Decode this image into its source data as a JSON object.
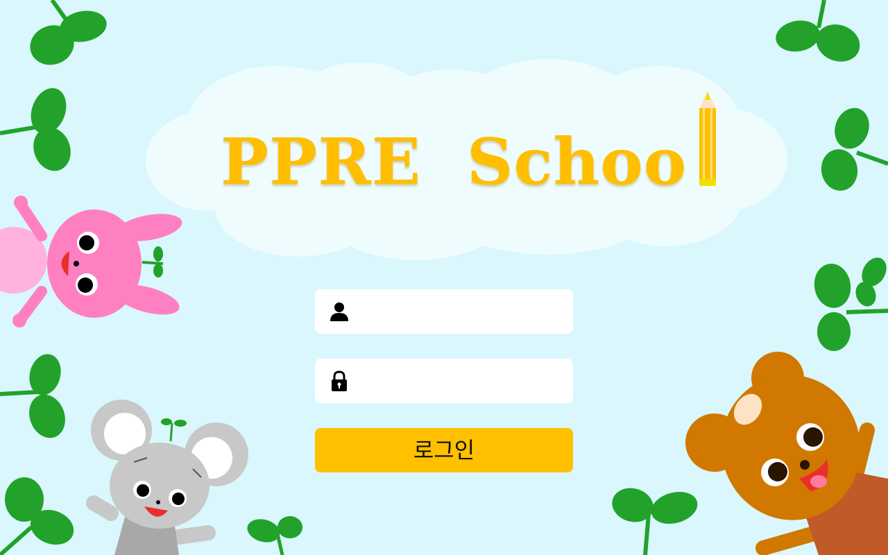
{
  "logo": {
    "title": "PPRE  Schoo"
  },
  "login_form": {
    "username_placeholder": "",
    "password_placeholder": "",
    "login_label": "로그인"
  },
  "icons": {
    "user": "user-icon",
    "lock": "lock-icon",
    "pencil": "pencil-icon"
  },
  "colors": {
    "background": "#d9f7fc",
    "accent": "#ffc000",
    "logo_text": "#ffbe00",
    "leaf": "#22a22a",
    "cloud": "#effcfe",
    "rabbit": "#ff80c0",
    "mouse": "#c8c8c8",
    "bear": "#d07800"
  }
}
